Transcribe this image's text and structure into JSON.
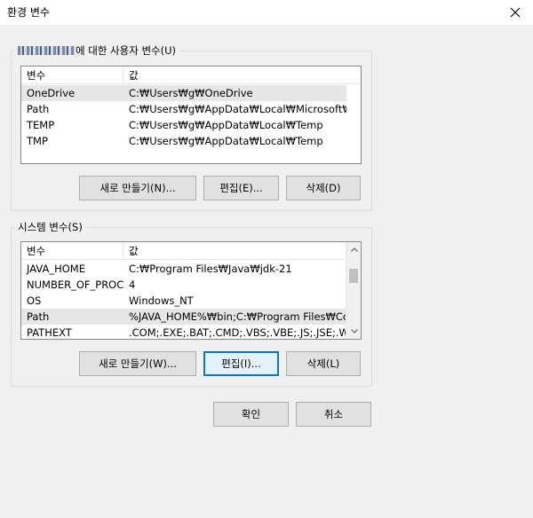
{
  "window": {
    "title": "환경 변수"
  },
  "user_vars": {
    "label": "에 대한 사용자 변수(U)",
    "columns": [
      "변수",
      "값"
    ],
    "rows": [
      {
        "name": "OneDrive",
        "value": "C:₩Users₩g₩OneDrive",
        "selected": true
      },
      {
        "name": "Path",
        "value": "C:₩Users₩g₩AppData₩Local₩Microsoft₩Wi..."
      },
      {
        "name": "TEMP",
        "value": "C:₩Users₩g₩AppData₩Local₩Temp"
      },
      {
        "name": "TMP",
        "value": "C:₩Users₩g₩AppData₩Local₩Temp"
      }
    ],
    "buttons": {
      "new": "새로 만들기(N)...",
      "edit": "편집(E)...",
      "delete": "삭제(D)"
    }
  },
  "system_vars": {
    "label": "시스템 변수(S)",
    "columns": [
      "변수",
      "값"
    ],
    "rows": [
      {
        "name": "JAVA_HOME",
        "value": "C:₩Program Files₩Java₩jdk-21"
      },
      {
        "name": "NUMBER_OF_PROC...",
        "value": "4"
      },
      {
        "name": "OS",
        "value": "Windows_NT"
      },
      {
        "name": "Path",
        "value": "%JAVA_HOME%₩bin;C:₩Program Files₩Com...",
        "selected": true
      },
      {
        "name": "PATHEXT",
        "value": ".COM;.EXE;.BAT;.CMD;.VBS;.VBE;.JS;.JSE;.WSF;..."
      }
    ],
    "buttons": {
      "new": "새로 만들기(W)...",
      "edit": "편집(I)...",
      "delete": "삭제(L)"
    }
  },
  "dialog_buttons": {
    "ok": "확인",
    "cancel": "취소"
  },
  "colors": {
    "selection": "#e6e6e6",
    "focus_border": "#0078d7"
  }
}
